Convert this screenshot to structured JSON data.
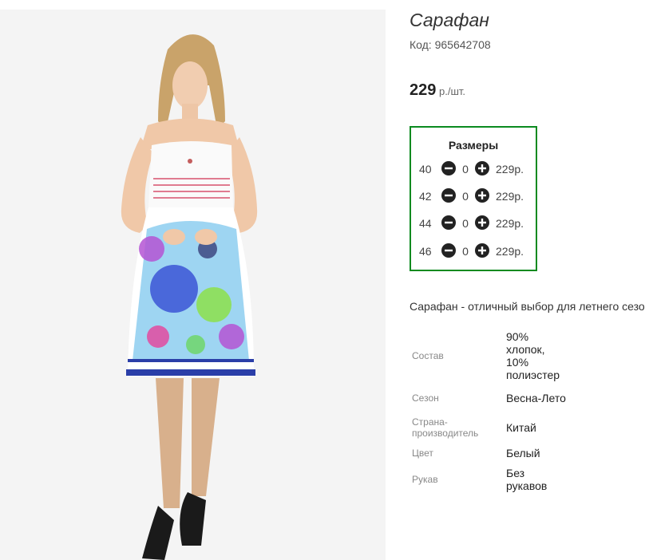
{
  "product": {
    "title": "Сарафан",
    "code_label": "Код:",
    "code": "965642708",
    "price": "229",
    "price_unit": "р./шт."
  },
  "sizes": {
    "title": "Размеры",
    "rows": [
      {
        "size": "40",
        "qty": "0",
        "price": "229р."
      },
      {
        "size": "42",
        "qty": "0",
        "price": "229р."
      },
      {
        "size": "44",
        "qty": "0",
        "price": "229р."
      },
      {
        "size": "46",
        "qty": "0",
        "price": "229р."
      }
    ]
  },
  "description": "Сарафан - отличный выбор для летнего сезо",
  "properties": [
    {
      "name": "Состав",
      "value": "90% хлопок, 10% полиэстер"
    },
    {
      "name": "Сезон",
      "value": "Весна-Лето"
    },
    {
      "name": "Страна-производитель",
      "value": "Китай"
    },
    {
      "name": "Цвет",
      "value": "Белый"
    },
    {
      "name": "Рукав",
      "value": "Без рукавов"
    }
  ],
  "colors": {
    "sizes_border": "#0a8a1f",
    "button": "#222222"
  },
  "icons": {
    "minus": "minus-circle-icon",
    "plus": "plus-circle-icon"
  }
}
